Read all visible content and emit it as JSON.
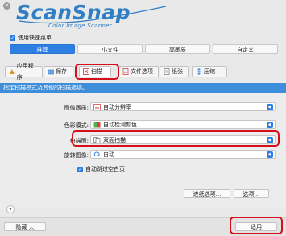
{
  "header": {
    "logo_text": "ScanSnap",
    "logo_subtitle": "Color Image Scanner",
    "close_icon": "close-icon",
    "quick_menu_label": "使用快速菜单"
  },
  "quick_menu": {
    "items": [
      {
        "label": "推荐",
        "active": true
      },
      {
        "label": "小文件",
        "active": false
      },
      {
        "label": "高画质",
        "active": false
      },
      {
        "label": "自定义",
        "active": false
      }
    ]
  },
  "tabs": [
    {
      "label": "应用程序",
      "icon": "app-icon"
    },
    {
      "label": "保存",
      "icon": "folder-icon"
    },
    {
      "label": "扫描",
      "icon": "scan-icon",
      "active": true
    },
    {
      "label": "文件选项",
      "icon": "file-options-icon"
    },
    {
      "label": "纸张",
      "icon": "paper-icon"
    },
    {
      "label": "压缩",
      "icon": "compression-icon"
    }
  ],
  "panel": {
    "title": "指定扫描模式及其他的扫描选项。",
    "image_quality_label": "图像画质:",
    "image_quality_value": "自动分辨率",
    "color_mode_label": "色彩模式:",
    "color_mode_value": "自动检测颜色",
    "scan_side_label": "扫描面:",
    "scan_side_value": "双面扫描",
    "rotation_label": "旋转图像:",
    "rotation_value": "自动",
    "skip_blank_label": "自动跳过空白页",
    "paper_options_button": "进纸选项...",
    "options_button": "选项..."
  },
  "footer": {
    "hide_button": "隐藏",
    "apply_button": "适用"
  },
  "colors": {
    "accent": "#2d7fe3",
    "panel_header": "#3e8ed9",
    "highlight": "#d5101b"
  }
}
